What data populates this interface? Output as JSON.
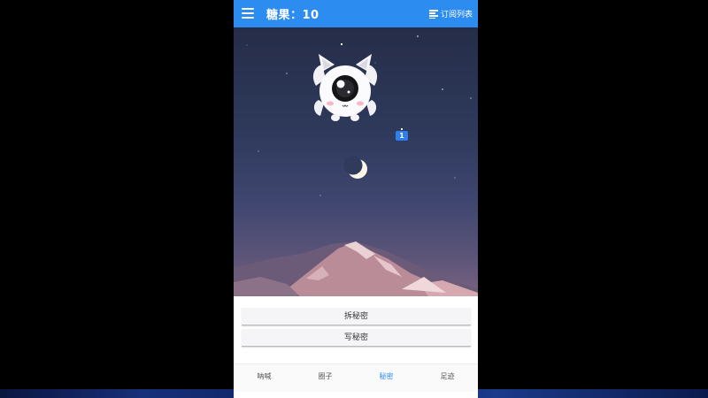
{
  "header": {
    "title": "糖果：10",
    "subscribe_label": "订阅列表",
    "menu_icon": "menu-icon",
    "list_icon": "list-icon"
  },
  "scene": {
    "badge": "1",
    "mascot_icon": "cyclops-cat-mascot",
    "moon_icon": "crescent-moon-icon"
  },
  "actions": {
    "open_secret": "拆秘密",
    "write_secret": "写秘密"
  },
  "tabs": [
    {
      "label": "呐喊",
      "active": false
    },
    {
      "label": "圈子",
      "active": false
    },
    {
      "label": "秘密",
      "active": true
    },
    {
      "label": "足迹",
      "active": false
    }
  ],
  "colors": {
    "primary": "#2d8cf0",
    "badge": "#2d7ff0"
  }
}
